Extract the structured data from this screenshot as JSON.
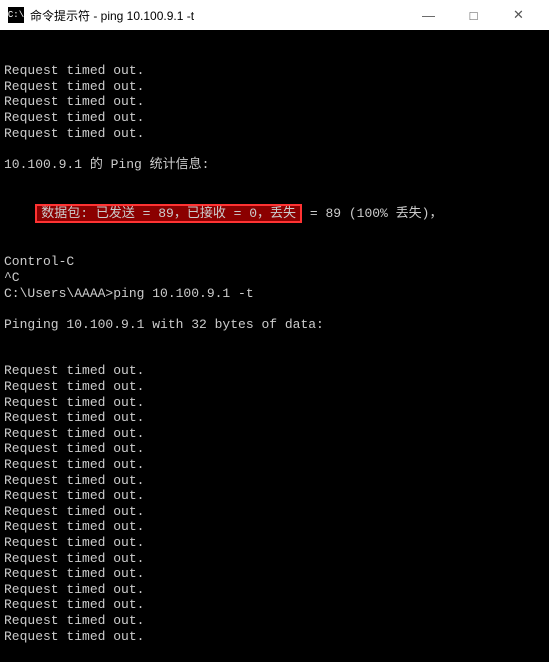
{
  "titlebar": {
    "icon_text": "C:\\",
    "title": "命令提示符 - ping  10.100.9.1 -t",
    "minimize": "—",
    "maximize": "□",
    "close": "✕"
  },
  "terminal": {
    "lines_top": [
      "Request timed out.",
      "Request timed out.",
      "Request timed out.",
      "Request timed out.",
      "Request timed out.",
      "",
      "10.100.9.1 的 Ping 统计信息:"
    ],
    "highlight_prefix": "    ",
    "highlight_text": "数据包: 已发送 = 89，已接收 = 0，丢失",
    "highlight_suffix": " = 89 (100% 丢失)，",
    "lines_mid": [
      "Control-C",
      "^C",
      "C:\\Users\\AAAA>ping 10.100.9.1 -t",
      "",
      "Pinging 10.100.9.1 with 32 bytes of data:"
    ],
    "lines_bottom": [
      "Request timed out.",
      "Request timed out.",
      "Request timed out.",
      "Request timed out.",
      "Request timed out.",
      "Request timed out.",
      "Request timed out.",
      "Request timed out.",
      "Request timed out.",
      "Request timed out.",
      "Request timed out.",
      "Request timed out.",
      "Request timed out.",
      "Request timed out.",
      "Request timed out.",
      "Request timed out.",
      "Request timed out.",
      "Request timed out."
    ]
  }
}
